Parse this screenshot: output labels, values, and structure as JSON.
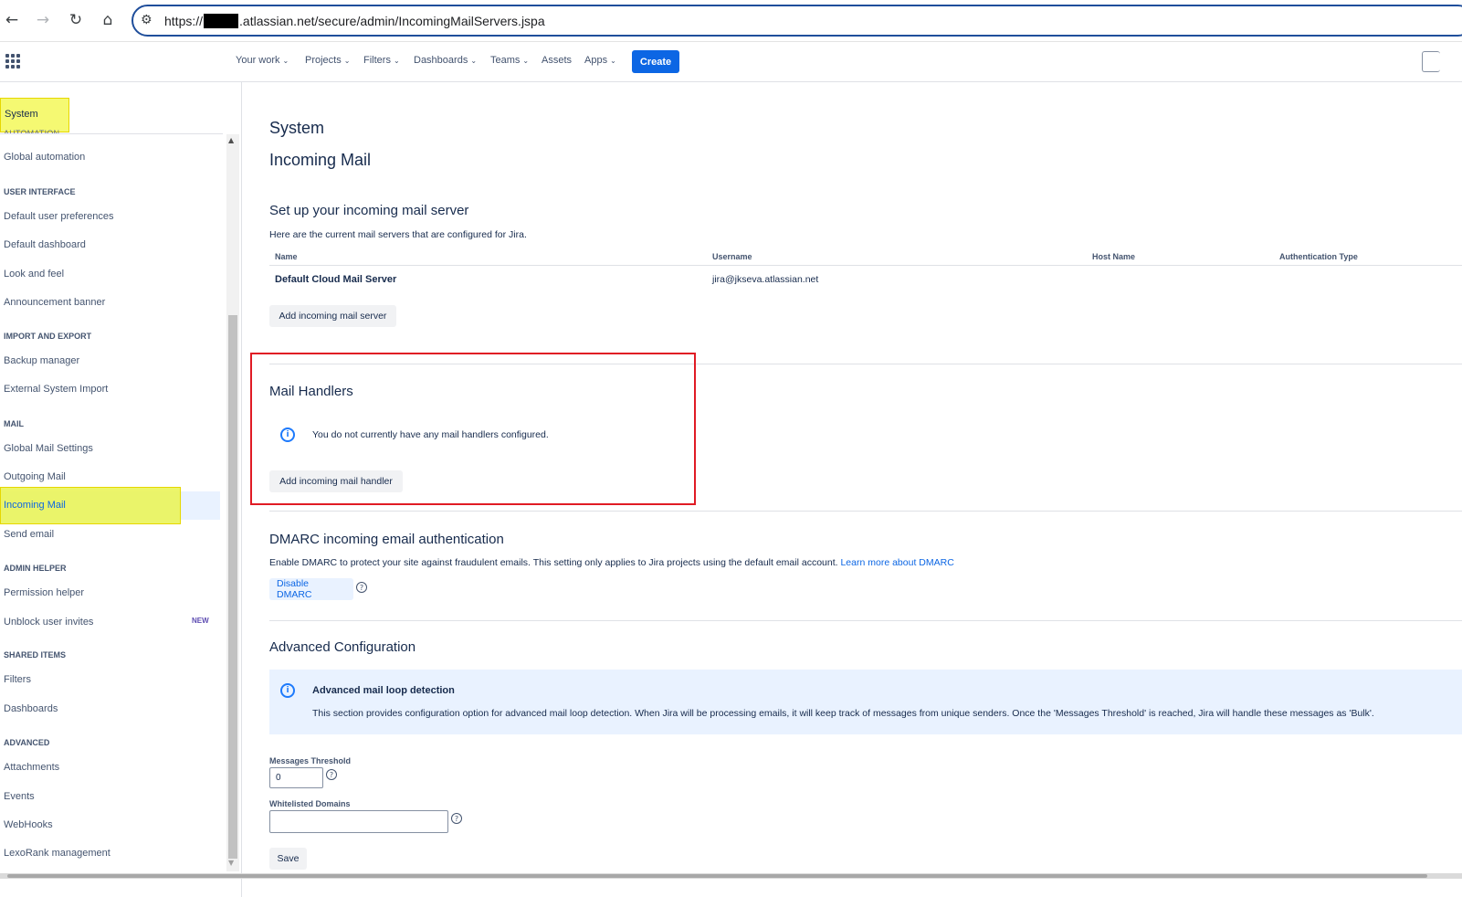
{
  "browser": {
    "url_prefix": "https://",
    "url_suffix": ".atlassian.net/secure/admin/IncomingMailServers.jspa",
    "back_icon": "arrow-left-icon",
    "forward_icon": "arrow-right-icon",
    "reload_icon": "reload-icon",
    "home_icon": "home-icon"
  },
  "topnav": {
    "items": [
      "Your work",
      "Projects",
      "Filters",
      "Dashboards",
      "Teams",
      "Assets",
      "Apps"
    ],
    "create_label": "Create"
  },
  "sidebar": {
    "title": "System",
    "cut_heading": "AUTOMATION",
    "items": {
      "global_automation": "Global automation",
      "h_user_interface": "USER INTERFACE",
      "default_user_prefs": "Default user preferences",
      "default_dashboard": "Default dashboard",
      "look_and_feel": "Look and feel",
      "announcement_banner": "Announcement banner",
      "h_import_export": "IMPORT AND EXPORT",
      "backup_manager": "Backup manager",
      "external_system_import": "External System Import",
      "h_mail": "MAIL",
      "global_mail_settings": "Global Mail Settings",
      "outgoing_mail": "Outgoing Mail",
      "incoming_mail": "Incoming Mail",
      "send_email": "Send email",
      "h_admin_helper": "ADMIN HELPER",
      "permission_helper": "Permission helper",
      "unblock_user_invites": "Unblock user invites",
      "new_badge": "NEW",
      "h_shared_items": "SHARED ITEMS",
      "filters": "Filters",
      "dashboards": "Dashboards",
      "h_advanced": "ADVANCED",
      "attachments": "Attachments",
      "events": "Events",
      "webhooks": "WebHooks",
      "lexorank": "LexoRank management"
    }
  },
  "main": {
    "title": "System",
    "subtitle": "Incoming Mail",
    "server_section": {
      "heading": "Set up your incoming mail server",
      "description": "Here are the current mail servers that are configured for Jira.",
      "columns": [
        "Name",
        "Username",
        "Host Name",
        "Authentication Type"
      ],
      "row": {
        "name": "Default Cloud Mail Server",
        "username": "jira@jkseva.atlassian.net"
      },
      "add_button": "Add incoming mail server"
    },
    "handlers_section": {
      "heading": "Mail Handlers",
      "info_text": "You do not currently have any mail handlers configured.",
      "add_button": "Add incoming mail handler"
    },
    "dmarc_section": {
      "heading": "DMARC incoming email authentication",
      "description": "Enable DMARC to protect your site against fraudulent emails. This setting only applies to Jira projects using the default email account.",
      "learn_more": "Learn more about DMARC",
      "disable_button": "Disable DMARC"
    },
    "advanced_section": {
      "heading": "Advanced Configuration",
      "panel_title": "Advanced mail loop detection",
      "panel_body": "This section provides configuration option for advanced mail loop detection. When Jira will be processing emails, it will keep track of messages from unique senders. Once the 'Messages Threshold' is reached, Jira will handle these messages as 'Bulk'.",
      "threshold_label": "Messages Threshold",
      "threshold_value": "0",
      "domains_label": "Whitelisted Domains",
      "domains_value": "",
      "save_button": "Save"
    }
  }
}
